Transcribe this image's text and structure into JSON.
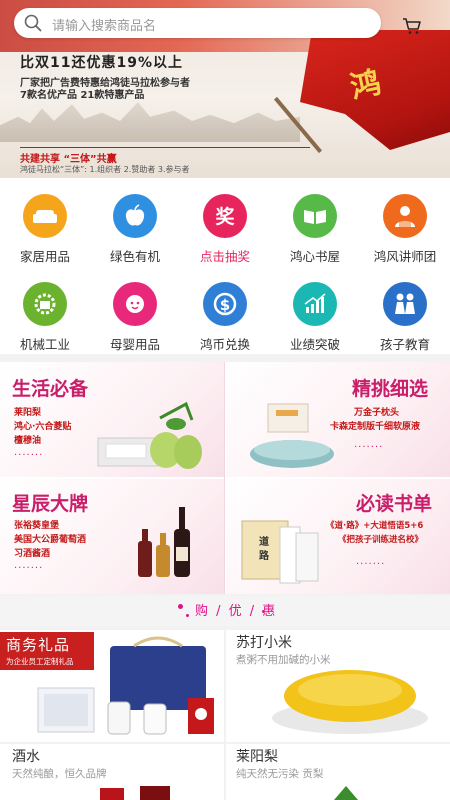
{
  "search": {
    "placeholder": "请输入搜索商品名",
    "icon": "search-icon"
  },
  "cart": {
    "icon": "cart-icon"
  },
  "banner": {
    "headline": "比双11还优惠19%以上",
    "line2": "厂家把广告费特惠给鸿徒马拉松参与者",
    "line3": "7款名优产品   21款特惠产品",
    "slogan": "共建共享   “三体”共赢",
    "slogan_sub": "鸿徒马拉松“三体”: 1.组织者  2.赞助者  3.参与者",
    "flag_char": "鸿"
  },
  "categories": [
    {
      "label": "家居用品",
      "icon": "sofa-icon",
      "color": "#f5a51c"
    },
    {
      "label": "绿色有机",
      "icon": "apple-icon",
      "color": "#2f8fe0"
    },
    {
      "label": "点击抽奖",
      "icon": "prize-icon",
      "color": "#e8245c",
      "highlight": true
    },
    {
      "label": "鸿心书屋",
      "icon": "book-icon",
      "color": "#56b948"
    },
    {
      "label": "鸿风讲师团",
      "icon": "teacher-icon",
      "color": "#f06a1d"
    },
    {
      "label": "机械工业",
      "icon": "factory-icon",
      "color": "#6bb22f"
    },
    {
      "label": "母婴用品",
      "icon": "baby-icon",
      "color": "#e8287a"
    },
    {
      "label": "鸿币兑换",
      "icon": "dollar-icon",
      "color": "#2f7fd6"
    },
    {
      "label": "业绩突破",
      "icon": "chart-icon",
      "color": "#1ab7b3"
    },
    {
      "label": "孩子教育",
      "icon": "children-icon",
      "color": "#2b70c8"
    }
  ],
  "promos": [
    {
      "title": "生活必备",
      "lines": [
        "莱阳梨",
        "鸿心·六合菱贴",
        "檀穆油"
      ],
      "dots": "·······"
    },
    {
      "title": "精挑细选",
      "lines": [
        "万金子枕头",
        "卡森定制版千细软原液"
      ],
      "dots": "·······"
    },
    {
      "title": "星辰大牌",
      "lines": [
        "张裕葵皇堡",
        "美国大公爵葡萄酒",
        "习酒酱酒"
      ],
      "dots": "·······"
    },
    {
      "title": "必读书单",
      "lines": [
        "《道·路》+大道悟语5+6",
        "《把孩子训练进名校》"
      ],
      "dots": "·······"
    }
  ],
  "section": {
    "title": "购 / 优 / 惠"
  },
  "products": [
    {
      "name": "商务礼品",
      "desc": "为企业员工定制礼品",
      "tag": true
    },
    {
      "name": "苏打小米",
      "desc": "煮粥不用加碱的小米"
    },
    {
      "name": "酒水",
      "desc": "天然纯酿，恒久品牌"
    },
    {
      "name": "莱阳梨",
      "desc": "纯天然无污染 贡梨"
    }
  ]
}
